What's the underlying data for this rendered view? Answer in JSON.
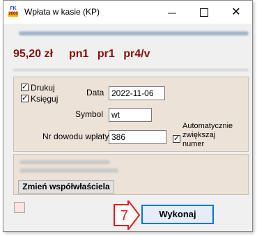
{
  "window": {
    "title": "Wpłata w kasie (KP)",
    "icon_text_top": "FK",
    "icon_text_bottom": "2000",
    "minimize_glyph": "—",
    "close_glyph": "✕"
  },
  "summary": {
    "amount": "95,20 zł",
    "codes": "pn1  pr1  pr4/v"
  },
  "options": {
    "print_label": "Drukuj",
    "print_checked": true,
    "post_label": "Księguj",
    "post_checked": true,
    "auto_increment_label_1": "Automatycznie",
    "auto_increment_label_2": "zwiększaj",
    "auto_increment_label_3": "numer",
    "auto_increment_checked": true
  },
  "fields": {
    "date_label": "Data",
    "date_value": "2022-11-06",
    "symbol_label": "Symbol",
    "symbol_value": "wt",
    "proof_label": "Nr dowodu wpłaty",
    "proof_value": "386"
  },
  "owner": {
    "change_button": "Zmień współwłaściela"
  },
  "actions": {
    "execute_button": "Wykonaj",
    "step_marker": "7"
  },
  "icons": {
    "checkbox": "checkmark-icon",
    "step_arrow": "red-arrow-icon"
  },
  "colors": {
    "accent_red": "#8b0d0d",
    "panel_bg": "#ede2d8",
    "focus_blue": "#0078d7"
  }
}
